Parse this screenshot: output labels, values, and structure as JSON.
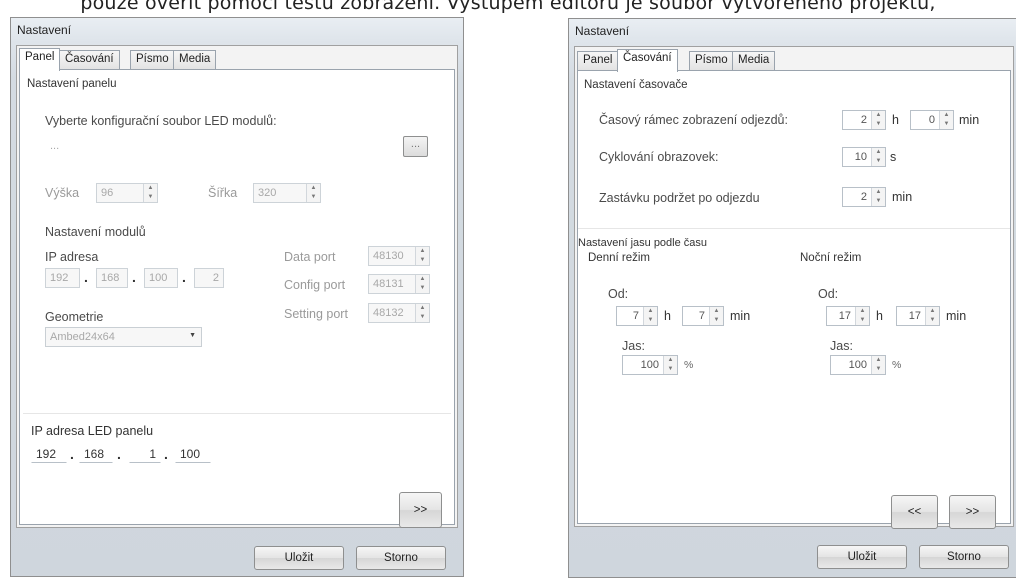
{
  "document": {
    "text": "pouze ověřit pomocí testu zobrazení. Výstupem editoru je soubor vytvořeného projektu,"
  },
  "left_window": {
    "title": "Nastavení",
    "tabs": [
      "Panel",
      "Časování",
      "Písmo",
      "Media"
    ],
    "active_tab": "Panel",
    "section_panel": "Nastavení panelu",
    "config_file_label": "Vyberte konfigurační soubor LED modulů:",
    "config_file_value": "...",
    "browse_label": "...",
    "height_label": "Výška",
    "height_value": "96",
    "width_label": "Šířka",
    "width_value": "320",
    "section_modules": "Nastavení modulů",
    "ip_label": "IP adresa",
    "ip_octets": [
      "192",
      "168",
      "100",
      "2"
    ],
    "geometry_label": "Geometrie",
    "geometry_value": "Ambed24x64",
    "data_port_label": "Data port",
    "data_port_value": "48130",
    "config_port_label": "Config port",
    "config_port_value": "48131",
    "setting_port_label": "Setting port",
    "setting_port_value": "48132",
    "led_ip_label": "IP adresa LED panelu",
    "led_ip_octets": [
      "192",
      "168",
      "1",
      "100"
    ],
    "next_label": ">>",
    "save_label": "Uložit",
    "cancel_label": "Storno"
  },
  "right_window": {
    "title": "Nastavení",
    "tabs": [
      "Panel",
      "Časování",
      "Písmo",
      "Media"
    ],
    "active_tab": "Časování",
    "section_timer": "Nastavení časovače",
    "timeframe_label": "Časový rámec zobrazení odjezdů:",
    "timeframe_hours": "2",
    "unit_h": "h",
    "timeframe_minutes": "0",
    "unit_min": "min",
    "cycle_label": "Cyklování obrazovek:",
    "cycle_value": "10",
    "unit_s": "s",
    "hold_label": "Zastávku podržet po odjezdu",
    "hold_value": "2",
    "section_brightness": "Nastavení jasu podle času",
    "day_mode": "Denní režim",
    "night_mode": "Noční režim",
    "from_label": "Od:",
    "day_from_h": "7",
    "day_from_min": "7",
    "night_from_h": "17",
    "night_from_min": "17",
    "brightness_label": "Jas:",
    "day_brightness": "100",
    "night_brightness": "100",
    "unit_percent": "%",
    "prev_label": "<<",
    "next_label": ">>",
    "save_label": "Uložit",
    "cancel_label": "Storno"
  }
}
